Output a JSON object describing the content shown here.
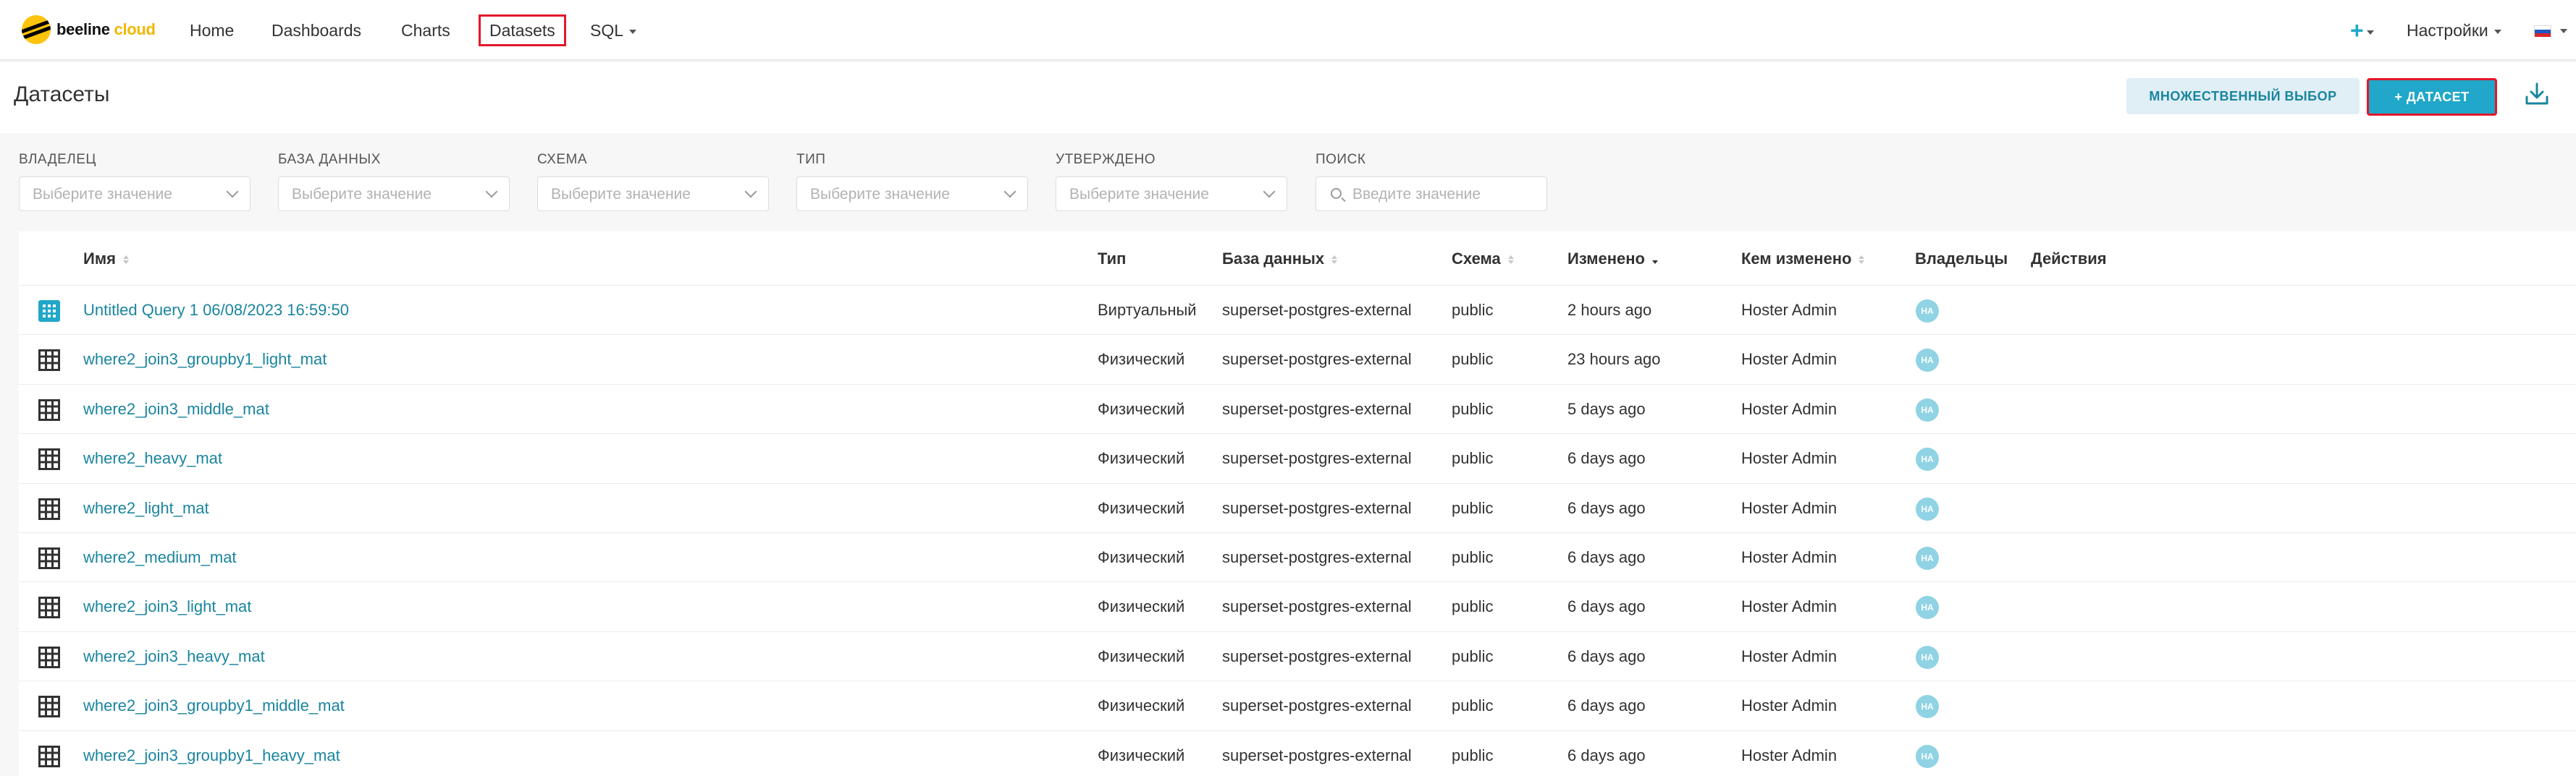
{
  "navbar": {
    "logo_text_main": "beeline",
    "logo_text_accent": "cloud",
    "items": [
      {
        "label": "Home"
      },
      {
        "label": "Dashboards"
      },
      {
        "label": "Charts"
      },
      {
        "label": "Datasets",
        "active": true
      },
      {
        "label": "SQL",
        "dropdown": true
      }
    ],
    "plus_label": "+",
    "settings_label": "Настройки",
    "language": "ru"
  },
  "header": {
    "title": "Датасеты",
    "bulk_select_label": "МНОЖЕСТВЕННЫЙ ВЫБОР",
    "add_dataset_label": "+ ДАТАСЕТ"
  },
  "filters": [
    {
      "label": "ВЛАДЕЛЕЦ",
      "placeholder": "Выберите значение"
    },
    {
      "label": "БАЗА ДАННЫХ",
      "placeholder": "Выберите значение"
    },
    {
      "label": "СХЕМА",
      "placeholder": "Выберите значение"
    },
    {
      "label": "ТИП",
      "placeholder": "Выберите значение"
    },
    {
      "label": "УТВЕРЖДЕНО",
      "placeholder": "Выберите значение"
    },
    {
      "label": "ПОИСК",
      "placeholder": "Введите значение"
    }
  ],
  "table": {
    "columns": [
      "Имя",
      "Тип",
      "База данных",
      "Схема",
      "Изменено",
      "Кем изменено",
      "Владельцы",
      "Действия"
    ],
    "rows": [
      {
        "name": "Untitled Query 1 06/08/2023 16:59:50",
        "type": "Виртуальный",
        "database": "superset-postgres-external",
        "schema": "public",
        "changed": "2 hours ago",
        "changed_by": "Hoster Admin",
        "owner": "HA",
        "icon": "virtual-dataset-icon"
      },
      {
        "name": "where2_join3_groupby1_light_mat",
        "type": "Физический",
        "database": "superset-postgres-external",
        "schema": "public",
        "changed": "23 hours ago",
        "changed_by": "Hoster Admin",
        "owner": "HA",
        "icon": "table-icon"
      },
      {
        "name": "where2_join3_middle_mat",
        "type": "Физический",
        "database": "superset-postgres-external",
        "schema": "public",
        "changed": "5 days ago",
        "changed_by": "Hoster Admin",
        "owner": "HA",
        "icon": "table-icon"
      },
      {
        "name": "where2_heavy_mat",
        "type": "Физический",
        "database": "superset-postgres-external",
        "schema": "public",
        "changed": "6 days ago",
        "changed_by": "Hoster Admin",
        "owner": "HA",
        "icon": "table-icon"
      },
      {
        "name": "where2_light_mat",
        "type": "Физический",
        "database": "superset-postgres-external",
        "schema": "public",
        "changed": "6 days ago",
        "changed_by": "Hoster Admin",
        "owner": "HA",
        "icon": "table-icon"
      },
      {
        "name": "where2_medium_mat",
        "type": "Физический",
        "database": "superset-postgres-external",
        "schema": "public",
        "changed": "6 days ago",
        "changed_by": "Hoster Admin",
        "owner": "HA",
        "icon": "table-icon"
      },
      {
        "name": "where2_join3_light_mat",
        "type": "Физический",
        "database": "superset-postgres-external",
        "schema": "public",
        "changed": "6 days ago",
        "changed_by": "Hoster Admin",
        "owner": "HA",
        "icon": "table-icon"
      },
      {
        "name": "where2_join3_heavy_mat",
        "type": "Физический",
        "database": "superset-postgres-external",
        "schema": "public",
        "changed": "6 days ago",
        "changed_by": "Hoster Admin",
        "owner": "HA",
        "icon": "table-icon"
      },
      {
        "name": "where2_join3_groupby1_middle_mat",
        "type": "Физический",
        "database": "superset-postgres-external",
        "schema": "public",
        "changed": "6 days ago",
        "changed_by": "Hoster Admin",
        "owner": "HA",
        "icon": "table-icon"
      },
      {
        "name": "where2_join3_groupby1_heavy_mat",
        "type": "Физический",
        "database": "superset-postgres-external",
        "schema": "public",
        "changed": "6 days ago",
        "changed_by": "Hoster Admin",
        "owner": "HA",
        "icon": "table-icon"
      }
    ]
  },
  "colors": {
    "accent": "#20a7c9",
    "link": "#1a85a0",
    "highlight": "#e4172a",
    "brand_yellow": "#fec30b"
  }
}
